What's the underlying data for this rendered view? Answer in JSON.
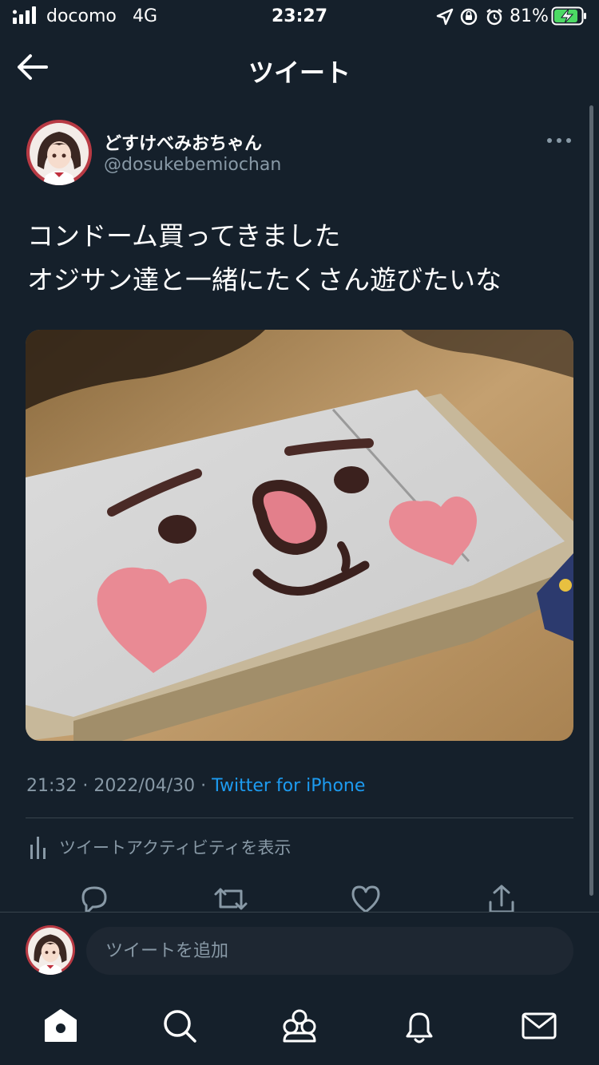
{
  "status_bar": {
    "carrier": "docomo",
    "network": "4G",
    "time": "23:27",
    "battery_percent": "81%",
    "icons": [
      "location-icon",
      "orientation-lock-icon",
      "alarm-icon",
      "battery-charging-icon"
    ]
  },
  "header": {
    "title": "ツイート",
    "back_icon": "back-arrow-icon"
  },
  "tweet": {
    "author": {
      "display_name": "どすけべみおちゃん",
      "handle": "@dosukebemiochan"
    },
    "text_lines": [
      "コンドーム買ってきました",
      "オジサン達と一緒にたくさん遊びたいな"
    ],
    "timestamp": "21:32 · 2022/04/30 · ",
    "source": "Twitter for iPhone",
    "activity_label": "ツイートアクティビティを表示",
    "actions": [
      "reply-icon",
      "retweet-icon",
      "like-icon",
      "share-icon"
    ]
  },
  "reply_bar": {
    "placeholder": "ツイートを追加"
  },
  "tab_bar": {
    "tabs": [
      "home-icon",
      "search-icon",
      "communities-icon",
      "notifications-icon",
      "messages-icon"
    ]
  },
  "colors": {
    "background": "#15202b",
    "link": "#1d9bf0",
    "secondary_text": "#8899a6",
    "divider": "#38444d"
  }
}
